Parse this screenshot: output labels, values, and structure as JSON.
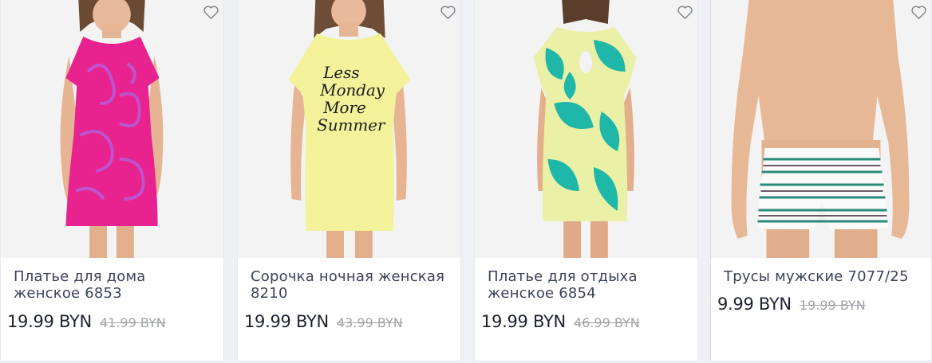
{
  "products": [
    {
      "name": "Платье для дома женское 6853",
      "price": "19.99 BYN",
      "old_price": "41.99 BYN",
      "image": "pink-swirl-dress-photo",
      "favorite_icon": "heart-outline-icon"
    },
    {
      "name": "Сорочка ночная женская 8210",
      "price": "19.99 BYN",
      "old_price": "43.99 BYN",
      "image": "yellow-nightshirt-photo",
      "print_text": "Less Monday More Summer",
      "favorite_icon": "heart-outline-icon"
    },
    {
      "name": "Платье для отдыха женское 6854",
      "price": "19.99 BYN",
      "old_price": "46.99 BYN",
      "image": "tropical-leaf-dress-photo",
      "favorite_icon": "heart-outline-icon"
    },
    {
      "name": "Трусы мужские 7077/25",
      "price": "9.99 BYN",
      "old_price": "19.99 BYN",
      "image": "striped-boxer-briefs-photo",
      "favorite_icon": "heart-outline-icon"
    }
  ],
  "colors": {
    "title_text": "#3a4358",
    "price_text": "#1e2230",
    "old_price_text": "#a0a3a9",
    "pink_dress": "#e8228f",
    "yellow_shirt": "#f3f19a",
    "tropical_teal": "#1fb8a8"
  }
}
